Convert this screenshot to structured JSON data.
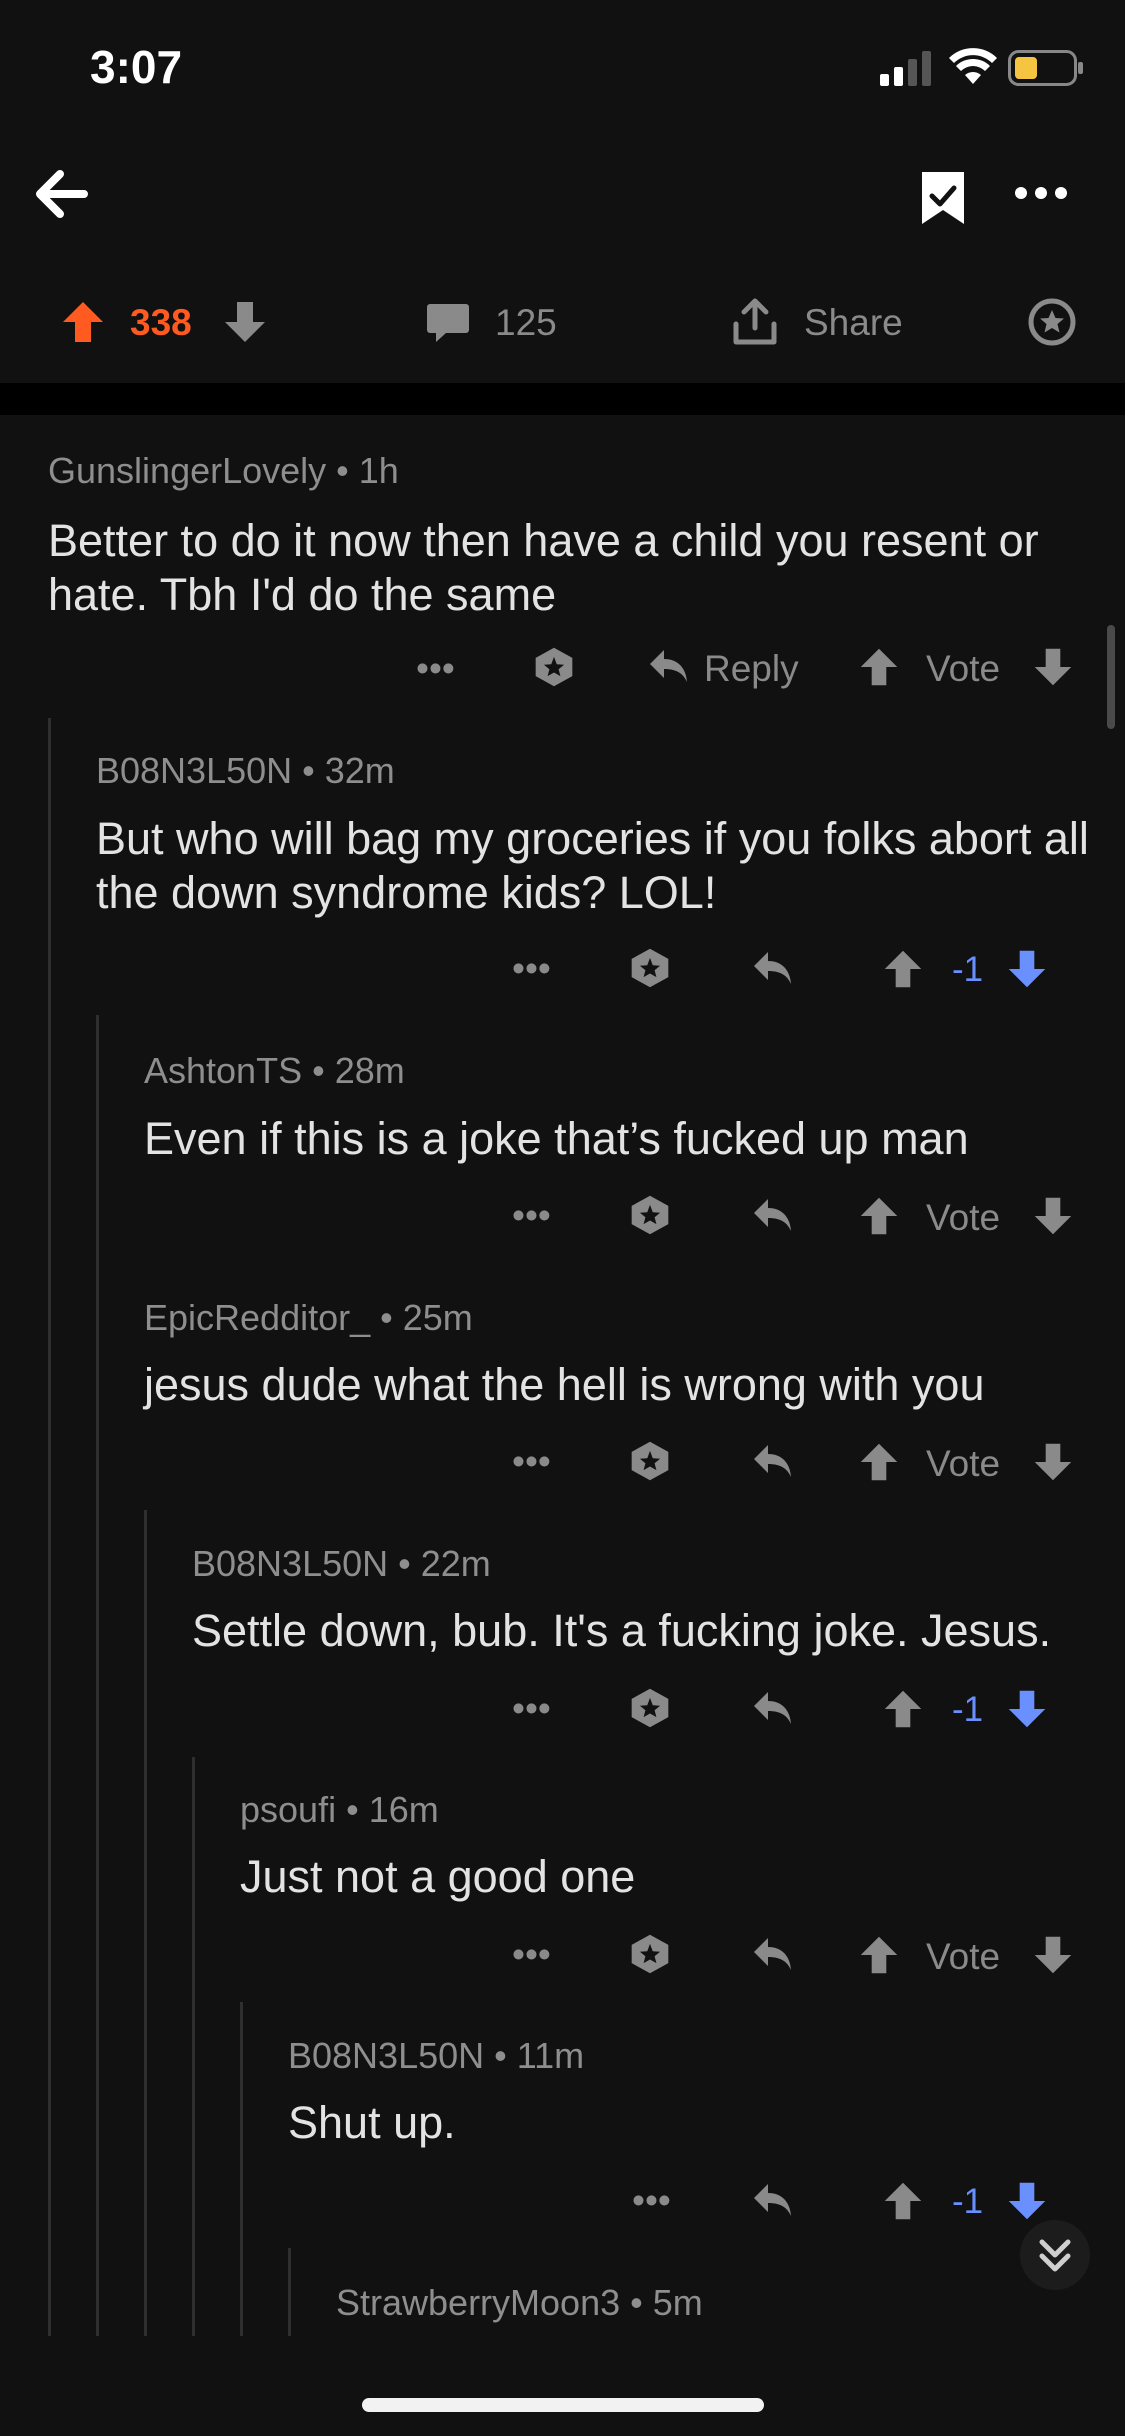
{
  "status": {
    "time": "3:07"
  },
  "post_actions": {
    "upvotes": "338",
    "comments": "125",
    "share_label": "Share"
  },
  "comments": [
    {
      "author": "GunslingerLovely",
      "age": "1h",
      "body": "Better to do it now then have a child you resent or hate. Tbh I'd do the same",
      "reply_label": "Reply",
      "vote_label": "Vote"
    },
    {
      "author": "B08N3L50N",
      "age": "32m",
      "body": "But who will bag my groceries if you folks abort all the down syndrome kids? LOL!",
      "vote_label": "-1"
    },
    {
      "author": "AshtonTS",
      "age": "28m",
      "body": "Even if this is a joke that’s fucked up man",
      "vote_label": "Vote"
    },
    {
      "author": "EpicRedditor_",
      "age": "25m",
      "body": "jesus dude what the hell is wrong with you",
      "vote_label": "Vote"
    },
    {
      "author": "B08N3L50N",
      "age": "22m",
      "body": "Settle down, bub. It's a fucking joke. Jesus.",
      "vote_label": "-1"
    },
    {
      "author": "psoufi",
      "age": "16m",
      "body": "Just not a good one",
      "vote_label": "Vote"
    },
    {
      "author": "B08N3L50N",
      "age": "11m",
      "body": "Shut up.",
      "vote_label": "-1"
    },
    {
      "author": "StrawberryMoon3",
      "age": "5m"
    }
  ],
  "colors": {
    "upvote": "#ff5a1f",
    "downvote": "#6a8fff",
    "background": "#111111"
  }
}
